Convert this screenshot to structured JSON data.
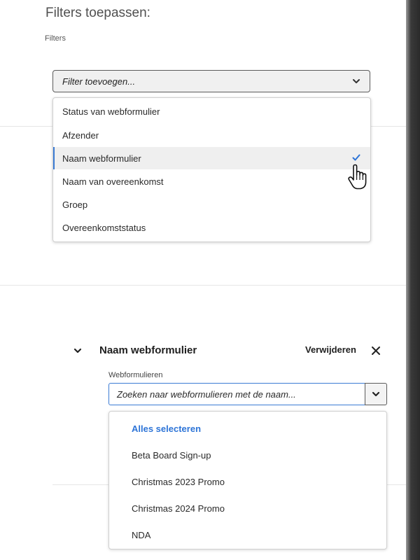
{
  "header": {
    "title": "Filters toepassen:",
    "subtitle": "Filters"
  },
  "filter_dropdown": {
    "placeholder": "Filter toevoegen...",
    "options": [
      {
        "label": "Status van webformulier",
        "selected": false
      },
      {
        "label": "Afzender",
        "selected": false
      },
      {
        "label": "Naam webformulier",
        "selected": true
      },
      {
        "label": "Naam van overeenkomst",
        "selected": false
      },
      {
        "label": "Groep",
        "selected": false
      },
      {
        "label": "Overeenkomststatus",
        "selected": false
      }
    ]
  },
  "section": {
    "title": "Naam webformulier",
    "remove_label": "Verwijderen",
    "field_label": "Webformulieren",
    "search_placeholder": "Zoeken naar webformulieren met de naam...",
    "items": [
      {
        "label": "Alles selecteren",
        "type": "select-all"
      },
      {
        "label": "Beta Board Sign-up"
      },
      {
        "label": "Christmas 2023 Promo"
      },
      {
        "label": "Christmas 2024 Promo"
      },
      {
        "label": "NDA"
      }
    ]
  },
  "colors": {
    "accent": "#2d74d7",
    "selected_bg": "#efefef",
    "text": "#2a2a2a"
  },
  "icons": {
    "dropdown": "chevron-down-icon",
    "check": "checkmark-icon",
    "cursor": "hand-pointer-icon",
    "collapse": "chevron-down-icon",
    "close": "close-icon"
  }
}
